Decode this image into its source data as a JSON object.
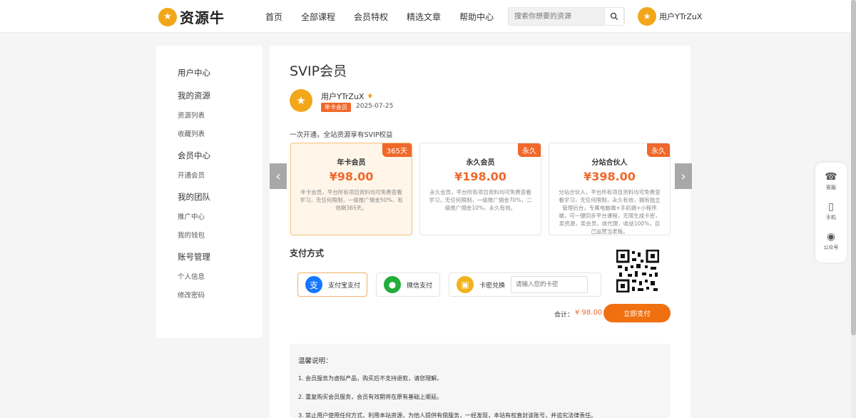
{
  "header": {
    "logo_text": "资源牛",
    "nav": [
      "首页",
      "全部课程",
      "会员特权",
      "精选文章",
      "帮助中心"
    ],
    "search_placeholder": "搜索你想要的资源",
    "user_name": "用户YTrZuX"
  },
  "sidebar": {
    "groups": [
      {
        "title": "用户中心",
        "items": []
      },
      {
        "title": "我的资源",
        "items": [
          "资源列表",
          "收藏列表"
        ]
      },
      {
        "title": "会员中心",
        "items": [
          "开通会员"
        ]
      },
      {
        "title": "我的团队",
        "items": [
          "推广中心",
          "我的钱包"
        ]
      },
      {
        "title": "账号管理",
        "items": [
          "个人信息",
          "修改密码"
        ]
      }
    ]
  },
  "main": {
    "title": "SVIP会员",
    "profile": {
      "name": "用户YTrZuX",
      "vip_tag": "年卡会员",
      "date": "2025-07-25"
    },
    "description": "一次开通，全站资源享有SVIP权益",
    "plans": [
      {
        "badge": "365天",
        "name": "年卡会员",
        "price": "¥98.00",
        "desc": "年卡会员，平台所有项目资料均可免费查看学习，无任何限制，一级推广佣金50%，有效期365天。",
        "active": true
      },
      {
        "badge": "永久",
        "name": "永久会员",
        "price": "¥198.00",
        "desc": "永久会员，平台所有项目资料均可免费查看学习，无任何限制，一级推广佣金70%，二级推广佣金10%，永久有效。",
        "active": false
      },
      {
        "badge": "永久",
        "name": "分站合伙人",
        "price": "¥398.00",
        "desc": "分站合伙人，平台所有项目资料均可免费查看学习，无任何限制，永久有效，拥有独立管理后台，专属电脑端+手机端+小程序端，可一键同步平台课程，无限生成卡密，卖资源，卖会员，收代理，收益100%，自己运营当老板。",
        "active": false
      }
    ],
    "pay_title": "支付方式",
    "pay_options": {
      "alipay": "支付宝支付",
      "wechat": "微信支付",
      "card": "卡密兑换",
      "card_placeholder": "请输入您的卡密"
    },
    "total_label": "合计：",
    "total_value": "¥ 98.00",
    "pay_button": "立即支付",
    "tips_title": "温馨说明：",
    "tips": [
      "1. 会员服务为虚拟产品，购买后不支持退款，请您理解。",
      "2. 重复购买会员服务，会员有效期将在原有基础上顺延。",
      "3. 禁止用户使用任何方式，利用本站资源，为他人提供有偿服务，一经发现，本站有权直封该账号，并追究法律责任。"
    ]
  },
  "float_bar": [
    "客服",
    "手机",
    "公众号"
  ],
  "colors": {
    "accent": "#f0682b",
    "brand": "#f2a71b",
    "button": "#f07010"
  }
}
